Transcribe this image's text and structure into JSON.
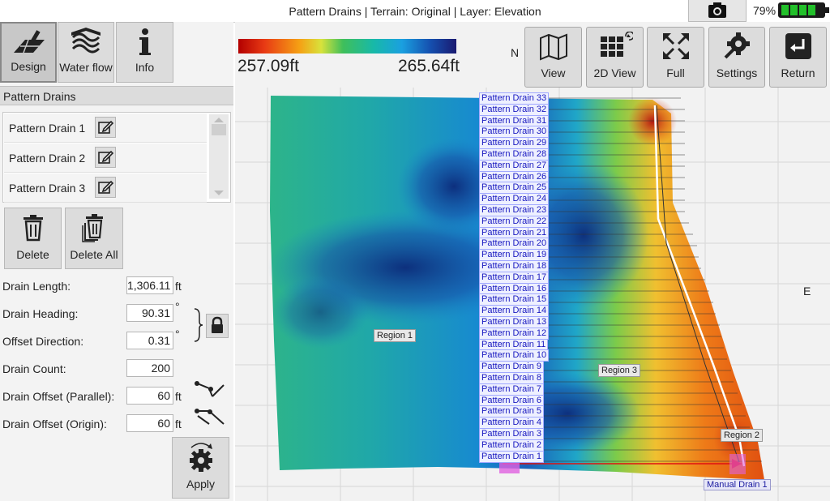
{
  "window": {
    "title": "Pattern Drains | Terrain: Original | Layer: Elevation",
    "battery_pct": "79%"
  },
  "tabs": [
    {
      "label": "Design",
      "icon": "design-icon"
    },
    {
      "label": "Water flow",
      "icon": "water-flow-icon"
    },
    {
      "label": "Info",
      "icon": "info-icon"
    }
  ],
  "panel": {
    "header": "Pattern Drains",
    "list_items": [
      "Pattern Drain 1",
      "Pattern Drain 2",
      "Pattern Drain 3"
    ],
    "delete_label": "Delete",
    "delete_all_label": "Delete All",
    "fields": {
      "drain_length": {
        "label": "Drain Length:",
        "value": "1,306.11",
        "unit": "ft"
      },
      "drain_heading": {
        "label": "Drain Heading:",
        "value": "90.31",
        "unit": "°"
      },
      "offset_direction": {
        "label": "Offset Direction:",
        "value": "0.31",
        "unit": "°"
      },
      "drain_count": {
        "label": "Drain Count:",
        "value": "200"
      },
      "drain_offset_parallel": {
        "label": "Drain Offset (Parallel):",
        "value": "60",
        "unit": "ft"
      },
      "drain_offset_origin": {
        "label": "Drain Offset (Origin):",
        "value": "60",
        "unit": "ft"
      }
    },
    "apply_label": "Apply"
  },
  "legend": {
    "min": "257.09ft",
    "max": "265.64ft",
    "colors": [
      "#b30000",
      "#e83a14",
      "#f5a014",
      "#d8e23c",
      "#3fbf5a",
      "#18b9a8",
      "#1aa0e0",
      "#1550b0",
      "#1a1a70"
    ]
  },
  "compass": {
    "north": "N",
    "east": "E"
  },
  "toolbar": [
    {
      "label": "View",
      "icon": "map-view-icon"
    },
    {
      "label": "2D View",
      "icon": "grid-2d-icon"
    },
    {
      "label": "Full",
      "icon": "fullscreen-icon"
    },
    {
      "label": "Settings",
      "icon": "settings-icon"
    },
    {
      "label": "Return",
      "icon": "return-icon"
    }
  ],
  "map": {
    "region_labels": [
      "Region 1",
      "Region 2",
      "Region 3"
    ],
    "drain_labels": [
      "Pattern Drain 33",
      "Pattern Drain 32",
      "Pattern Drain 31",
      "Pattern Drain 30",
      "Pattern Drain 29",
      "Pattern Drain 28",
      "Pattern Drain 27",
      "Pattern Drain 26",
      "Pattern Drain 25",
      "Pattern Drain 24",
      "Pattern Drain 23",
      "Pattern Drain 22",
      "Pattern Drain 21",
      "Pattern Drain 20",
      "Pattern Drain 19",
      "Pattern Drain 18",
      "Pattern Drain 17",
      "Pattern Drain 16",
      "Pattern Drain 15",
      "Pattern Drain 14",
      "Pattern Drain 13",
      "Pattern Drain 12",
      "Pattern Drain 11",
      "Pattern Drain 10",
      "Pattern Drain 9",
      "Pattern Drain 8",
      "Pattern Drain 7",
      "Pattern Drain 6",
      "Pattern Drain 5",
      "Pattern Drain 4",
      "Pattern Drain 3",
      "Pattern Drain 2",
      "Pattern Drain 1"
    ],
    "manual_drain_label": "Manual Drain 1"
  }
}
